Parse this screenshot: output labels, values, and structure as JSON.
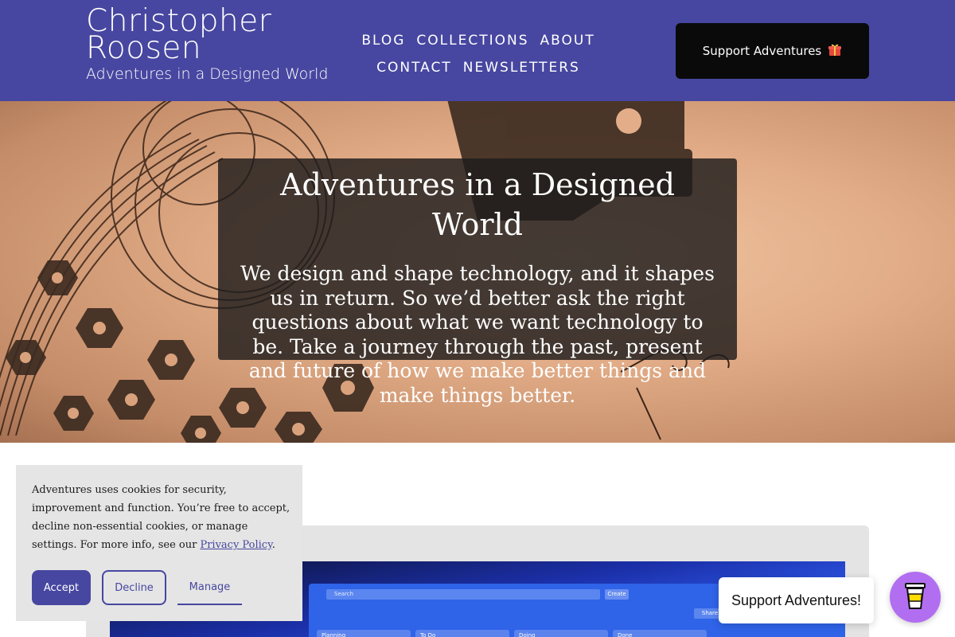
{
  "header": {
    "brand_name_line1": "Christopher",
    "brand_name_line2": "Roosen",
    "tagline": "Adventures in a Designed World",
    "nav": [
      {
        "label": "BLOG"
      },
      {
        "label": "COLLECTIONS"
      },
      {
        "label": "ABOUT"
      },
      {
        "label": "CONTACT"
      },
      {
        "label": "NEWSLETTERS"
      }
    ],
    "support_label": "Support Adventures",
    "support_icon": "gift-icon"
  },
  "hero": {
    "title": "Adventures in a Designed World",
    "text": "We design and shape technology, and it shapes us in return. So we’d better ask the right questions about what we want technology to be. Take a journey through the past, present and future of how we make better things and make things better."
  },
  "screenshot": {
    "search": "Search",
    "create": "Create",
    "share": "Share",
    "columns": [
      "Planning",
      "To Do",
      "Doing",
      "Done"
    ]
  },
  "cookie": {
    "text": "Adventures uses cookies for security, improvement and function. You’re free to accept, decline non-essential cookies, or manage settings. For more info, see our ",
    "link": "Privacy Policy",
    "after": ".",
    "accept": "Accept",
    "decline": "Decline",
    "manage": "Manage"
  },
  "floating": {
    "label": "Support Adventures!",
    "icon": "coffee-cup-icon"
  },
  "colors": {
    "brand": "#4747a1",
    "support_button": "#0a0a0a",
    "floating_button": "#b26ef0"
  }
}
